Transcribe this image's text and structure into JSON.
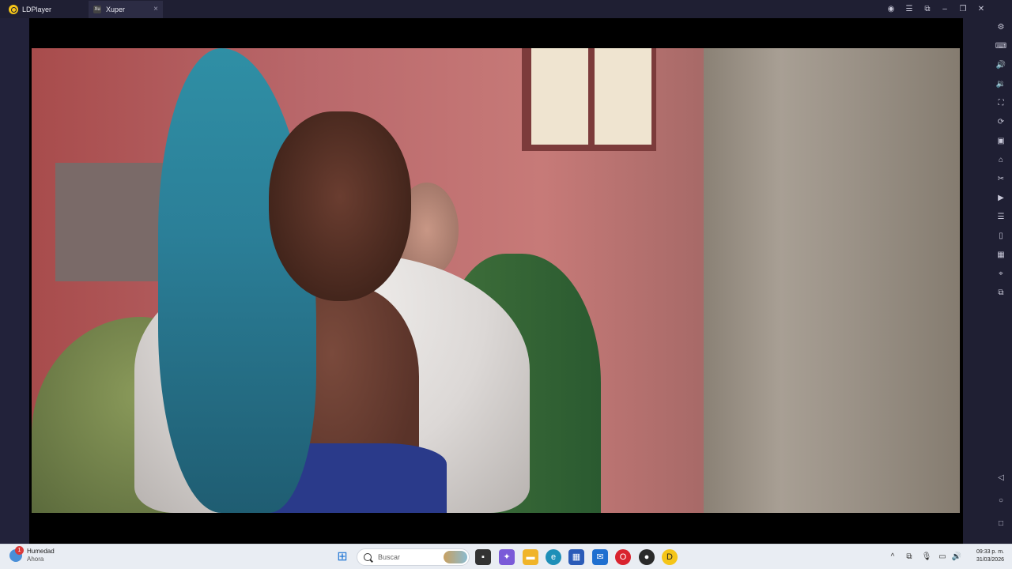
{
  "titlebar": {
    "app_name": "LDPlayer",
    "tab_label": "Xuper",
    "tab_icon_text": "Xu",
    "tab_close": "×",
    "controls": {
      "account": "◉",
      "menu": "☰",
      "fullscreen": "⧉",
      "minimize": "–",
      "restore": "❐",
      "close": "✕"
    }
  },
  "sidebar": {
    "icons": [
      "⚙",
      "⌨",
      "🔊",
      "🔉",
      "⛶",
      "⟳",
      "▣",
      "⌂",
      "✂",
      "▶",
      "☰",
      "▯",
      "▦",
      "⌖",
      "⧉"
    ],
    "nav": {
      "back": "◁",
      "home": "○",
      "recent": "□"
    }
  },
  "taskbar": {
    "weather": {
      "title": "Humedad",
      "subtitle": "Ahora",
      "badge": "1"
    },
    "search_placeholder": "Buscar",
    "apps": [
      {
        "name": "windows-start",
        "glyph": "⊞",
        "color": "#1e74d4"
      },
      {
        "name": "task-view",
        "glyph": "▪",
        "color": "#333333"
      },
      {
        "name": "copilot",
        "glyph": "✦",
        "color": "#7a5ad8"
      },
      {
        "name": "file-explorer",
        "glyph": "▬",
        "color": "#f0b429"
      },
      {
        "name": "edge",
        "glyph": "e",
        "color": "#1e8fb8"
      },
      {
        "name": "microsoft-store",
        "glyph": "▦",
        "color": "#2a5bb8"
      },
      {
        "name": "outlook",
        "glyph": "✉",
        "color": "#1f6fd0"
      },
      {
        "name": "opera",
        "glyph": "O",
        "color": "#d9232e"
      },
      {
        "name": "recorder",
        "glyph": "●",
        "color": "#2a2a2a"
      },
      {
        "name": "ldplayer",
        "glyph": "D",
        "color": "#f5c518"
      }
    ],
    "tray": {
      "chevron": "^",
      "network": "⧉",
      "mic": "🎙",
      "display": "▭",
      "volume": "🔊"
    },
    "clock": {
      "time": "09:33 p. m.",
      "date": "31/03/2026"
    }
  }
}
